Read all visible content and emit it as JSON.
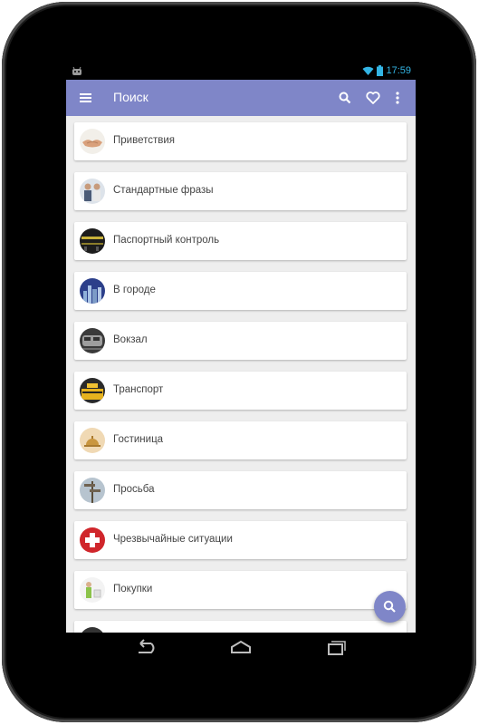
{
  "status": {
    "time": "17:59",
    "left_icon": "android-icon",
    "wifi_icon": "wifi-icon",
    "battery_icon": "battery-icon"
  },
  "appbar": {
    "title": "Поиск",
    "menu_icon": "hamburger-icon",
    "search_icon": "search-icon",
    "favorite_icon": "heart-outline-icon",
    "overflow_icon": "more-vert-icon",
    "background": "#7f86c8"
  },
  "list": {
    "items": [
      {
        "label": "Приветствия",
        "image": "handshake"
      },
      {
        "label": "Стандартные фразы",
        "image": "people-talking"
      },
      {
        "label": "Паспортный контроль",
        "image": "passport-control"
      },
      {
        "label": "В городе",
        "image": "city-skyline"
      },
      {
        "label": "Вокзал",
        "image": "train"
      },
      {
        "label": "Транспорт",
        "image": "taxi"
      },
      {
        "label": "Гостиница",
        "image": "hotel-bell"
      },
      {
        "label": "Просьба",
        "image": "signpost"
      },
      {
        "label": "Чрезвычайные ситуации",
        "image": "red-cross"
      },
      {
        "label": "Покупки",
        "image": "shopping"
      }
    ]
  },
  "fab": {
    "icon": "search-icon",
    "color": "#7f86c8"
  },
  "navbar": {
    "back_icon": "back-icon",
    "home_icon": "home-icon",
    "recents_icon": "recents-icon"
  }
}
